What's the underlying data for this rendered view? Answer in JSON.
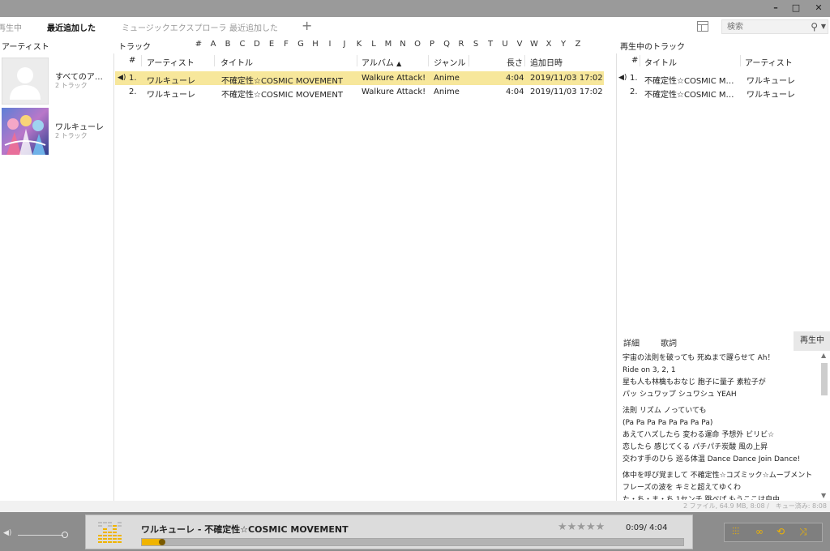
{
  "window": {
    "min_label": "–",
    "max_label": "□",
    "close_label": "✕"
  },
  "tabs": {
    "items": [
      "再生中",
      "最近追加した",
      "ミュージックエクスプローラ",
      "最近追加した"
    ],
    "add_label": "+"
  },
  "search": {
    "placeholder": "検索"
  },
  "panes": {
    "artist_header": "アーティスト",
    "track_header": "トラック",
    "queue_header": "再生中のトラック"
  },
  "alphabet": [
    "#",
    "A",
    "B",
    "C",
    "D",
    "E",
    "F",
    "G",
    "H",
    "I",
    "J",
    "K",
    "L",
    "M",
    "N",
    "O",
    "P",
    "Q",
    "R",
    "S",
    "T",
    "U",
    "V",
    "W",
    "X",
    "Y",
    "Z"
  ],
  "artists": [
    {
      "name": "すべてのア…",
      "count": "2 トラック"
    },
    {
      "name": "ワルキューレ",
      "count": "2 トラック"
    }
  ],
  "track_table": {
    "columns": {
      "num": "#",
      "artist": "アーティスト",
      "title": "タイトル",
      "album": "アルバム",
      "genre": "ジャンル",
      "length": "長さ",
      "added": "追加日時"
    },
    "sort_indicator": "▲",
    "rows": [
      {
        "num": "1.",
        "artist": "ワルキューレ",
        "title": "不確定性☆COSMIC MOVEMENT",
        "album": "Walkure Attack!",
        "genre": "Anime",
        "length": "4:04",
        "added": "2019/11/03 17:02",
        "playing": true
      },
      {
        "num": "2.",
        "artist": "ワルキューレ",
        "title": "不確定性☆COSMIC MOVEMENT",
        "album": "Walkure Attack!",
        "genre": "Anime",
        "length": "4:04",
        "added": "2019/11/03 17:02",
        "playing": false
      }
    ]
  },
  "queue": {
    "columns": {
      "num": "#",
      "title": "タイトル",
      "artist": "アーティスト"
    },
    "rows": [
      {
        "num": "1.",
        "title": "不確定性☆COSMIC M…",
        "artist": "ワルキューレ",
        "playing": true
      },
      {
        "num": "2.",
        "title": "不確定性☆COSMIC M…",
        "artist": "ワルキューレ",
        "playing": false
      }
    ]
  },
  "info": {
    "tab_details": "詳細",
    "tab_lyrics": "歌詞",
    "tab_playing": "再生中",
    "lyrics": [
      [
        "宇宙の法則を破っても 死ぬまで躍らせて Ah！",
        "Ride on 3, 2, 1",
        "星も人も林檎もおなじ 胞子に量子 素粒子が",
        "パッ シュワップ シュワシュ YEAH"
      ],
      [
        "法則 リズム ノっていても",
        "(Pa Pa Pa Pa Pa Pa Pa Pa)",
        "あえてハズしたら 変わる運命 予想外 ビリビ☆",
        "恋したら 感じてくる パチパチ炭酸 風の上昇",
        "交わす手のひら 巡る体温 Dance Dance Join Dance!"
      ],
      [
        "体中を呼び覚まして 不確定性☆コズミック☆ムーブメント",
        "フレーズの波を キミと超えてゆくわ",
        "た・ち・ま・ち 1センチ 跳べば もうここは自由"
      ]
    ]
  },
  "status": {
    "text": "2 ファイル, 64.9 MB, 8:08 /　キュー済み: 8:08"
  },
  "player": {
    "now_playing": "ワルキューレ - 不確定性☆COSMIC MOVEMENT",
    "rating_stars": "★★★★★",
    "rating_value": 0,
    "time": "0:09/ 4:04",
    "progress": 0.037,
    "volume": 1.0,
    "accent_color": "#f0b400"
  }
}
